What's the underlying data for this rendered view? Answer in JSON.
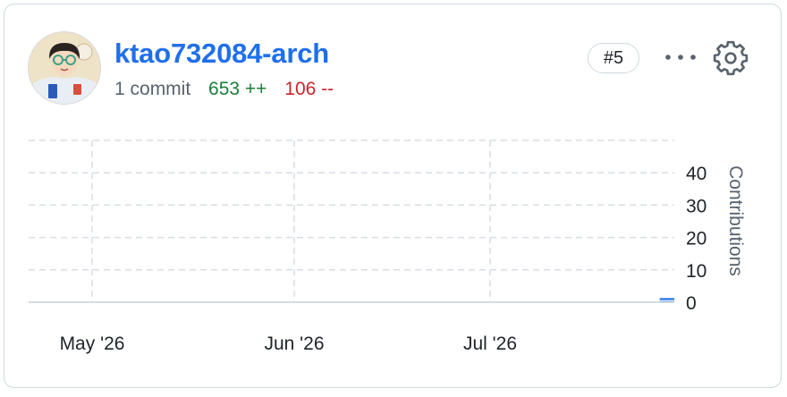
{
  "user": {
    "username": "ktao732084-arch",
    "commits": "1 commit",
    "additions": "653 ++",
    "deletions": "106 --",
    "rank": "#5"
  },
  "icons": {
    "more": "kebab-horizontal-icon",
    "settings": "gear-icon"
  },
  "colors": {
    "accent": "#1f6feb",
    "additions": "#1a7f37",
    "deletions": "#cf222e",
    "grid": "#d8dee4"
  },
  "chart_data": {
    "type": "area",
    "x_ticks": [
      "May '26",
      "Jun '26",
      "Jul '26"
    ],
    "y_ticks": [
      "0",
      "10",
      "20",
      "30",
      "40"
    ],
    "ylabel": "Contributions",
    "ylim": [
      0,
      50
    ],
    "grid": true,
    "series": [
      {
        "x": [
          "2026-07-27",
          "2026-08-03"
        ],
        "values": [
          1,
          1
        ]
      }
    ]
  }
}
